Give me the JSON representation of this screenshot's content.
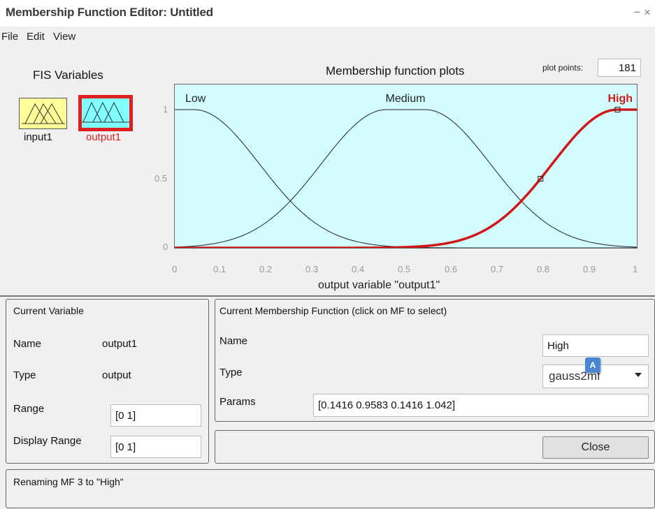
{
  "window": {
    "title": "Membership Function Editor: Untitled",
    "controls": "− ×"
  },
  "menu": {
    "file": "File",
    "edit": "Edit",
    "view": "View"
  },
  "fis": {
    "title": "FIS Variables",
    "input_label": "input1",
    "output_label": "output1",
    "selected_color": "#e02020",
    "input_color": "#ffff99",
    "output_color": "#7fffff"
  },
  "plot": {
    "title": "Membership function plots",
    "plot_points_label": "plot points:",
    "plot_points_value": "181",
    "xlabel": "output variable \"output1\"",
    "mf_labels": {
      "low": "Low",
      "medium": "Medium",
      "high": "High"
    },
    "highlight_color": "#d01818",
    "background": "#d2fcfd",
    "xticks": [
      "0",
      "0.1",
      "0.2",
      "0.3",
      "0.4",
      "0.5",
      "0.6",
      "0.7",
      "0.8",
      "0.9",
      "1"
    ],
    "yticks": [
      "1",
      "0.5",
      "0"
    ],
    "xlim": [
      0,
      1
    ],
    "ylim": [
      0,
      1
    ]
  },
  "current_variable": {
    "title": "Current Variable",
    "name_label": "Name",
    "name_value": "output1",
    "type_label": "Type",
    "type_value": "output",
    "range_label": "Range",
    "range_value": "[0 1]",
    "display_range_label": "Display Range",
    "display_range_value": "[0 1]"
  },
  "current_mf": {
    "title": "Current Membership Function (click on MF to select)",
    "name_label": "Name",
    "name_value": "High",
    "type_label": "Type",
    "type_value": "gauss2mf",
    "params_label": "Params",
    "params_value": "[0.1416 0.9583 0.1416 1.042]"
  },
  "close_button": "Close",
  "status": "Renaming MF 3 to \"High\"",
  "overlay_badge": "A"
}
